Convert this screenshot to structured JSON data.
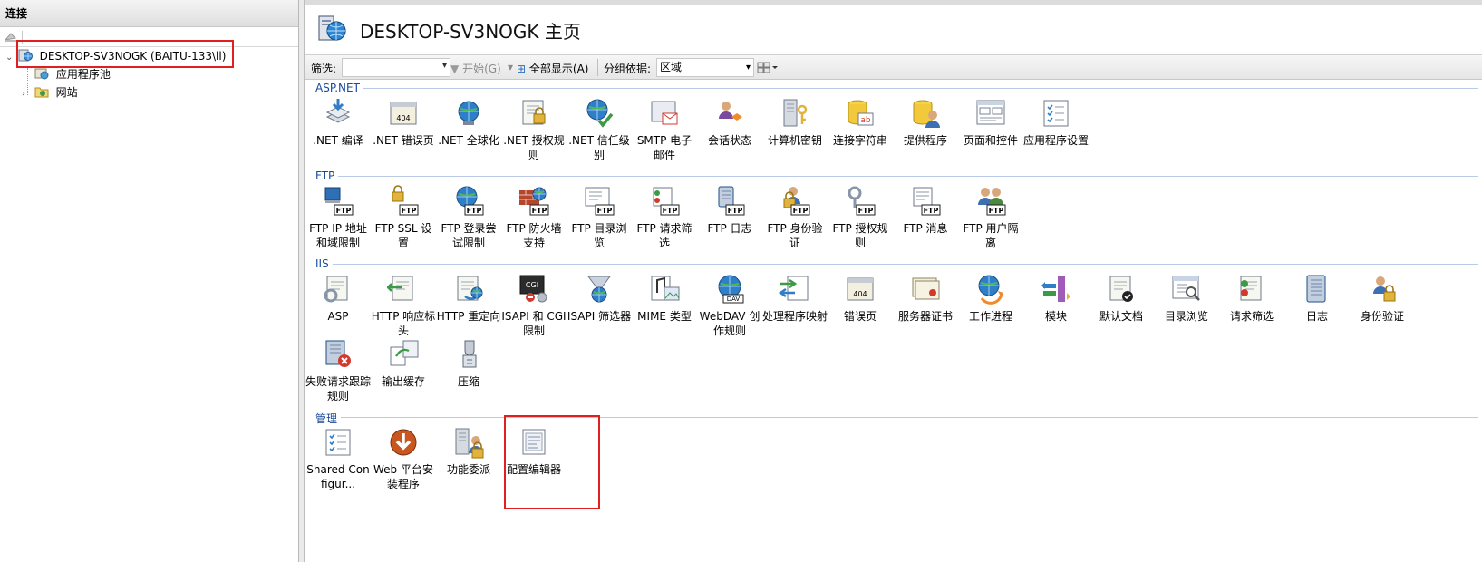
{
  "connections": {
    "header": "连接",
    "tree": {
      "server": "DESKTOP-SV3NOGK (BAITU-133\\ll)",
      "app_pools": "应用程序池",
      "sites": "网站"
    }
  },
  "title": "DESKTOP-SV3NOGK 主页",
  "filterbar": {
    "filter_label": "筛选:",
    "filter_value": "",
    "start_label": "开始(G)",
    "show_all_label": "全部显示(A)",
    "group_label": "分组依据:",
    "group_value": "区域"
  },
  "sections": [
    {
      "name": "ASP.NET",
      "items": [
        {
          "label": ".NET 编译",
          "icon": "compile-icon"
        },
        {
          "label": ".NET 错误页",
          "icon": "error-page-icon"
        },
        {
          "label": ".NET 全球化",
          "icon": "globe-icon"
        },
        {
          "label": ".NET 授权规则",
          "icon": "authz-icon"
        },
        {
          "label": ".NET 信任级别",
          "icon": "trust-icon"
        },
        {
          "label": "SMTP 电子邮件",
          "icon": "mail-icon"
        },
        {
          "label": "会话状态",
          "icon": "session-icon"
        },
        {
          "label": "计算机密钥",
          "icon": "machine-key-icon"
        },
        {
          "label": "连接字符串",
          "icon": "conn-string-icon"
        },
        {
          "label": "提供程序",
          "icon": "providers-icon"
        },
        {
          "label": "页面和控件",
          "icon": "pages-controls-icon"
        },
        {
          "label": "应用程序设置",
          "icon": "app-settings-icon"
        }
      ]
    },
    {
      "name": "FTP",
      "items": [
        {
          "label": "FTP IP 地址和域限制",
          "icon": "ftp-ip-icon"
        },
        {
          "label": "FTP SSL 设置",
          "icon": "ftp-ssl-icon"
        },
        {
          "label": "FTP 登录尝试限制",
          "icon": "ftp-logon-icon"
        },
        {
          "label": "FTP 防火墙支持",
          "icon": "ftp-firewall-icon"
        },
        {
          "label": "FTP 目录浏览",
          "icon": "ftp-dir-icon"
        },
        {
          "label": "FTP 请求筛选",
          "icon": "ftp-filter-icon"
        },
        {
          "label": "FTP 日志",
          "icon": "ftp-log-icon"
        },
        {
          "label": "FTP 身份验证",
          "icon": "ftp-auth-icon"
        },
        {
          "label": "FTP 授权规则",
          "icon": "ftp-authz-icon"
        },
        {
          "label": "FTP 消息",
          "icon": "ftp-message-icon"
        },
        {
          "label": "FTP 用户隔离",
          "icon": "ftp-isolation-icon"
        }
      ]
    },
    {
      "name": "IIS",
      "items": [
        {
          "label": "ASP",
          "icon": "asp-icon"
        },
        {
          "label": "HTTP 响应标头",
          "icon": "http-headers-icon"
        },
        {
          "label": "HTTP 重定向",
          "icon": "http-redirect-icon"
        },
        {
          "label": "ISAPI 和 CGI 限制",
          "icon": "isapi-cgi-icon"
        },
        {
          "label": "ISAPI 筛选器",
          "icon": "isapi-filter-icon"
        },
        {
          "label": "MIME 类型",
          "icon": "mime-icon"
        },
        {
          "label": "WebDAV 创作规则",
          "icon": "webdav-icon"
        },
        {
          "label": "处理程序映射",
          "icon": "handler-icon"
        },
        {
          "label": "错误页",
          "icon": "error-page-icon"
        },
        {
          "label": "服务器证书",
          "icon": "certificate-icon"
        },
        {
          "label": "工作进程",
          "icon": "worker-process-icon"
        },
        {
          "label": "模块",
          "icon": "modules-icon"
        },
        {
          "label": "默认文档",
          "icon": "default-doc-icon"
        },
        {
          "label": "目录浏览",
          "icon": "dir-browse-icon"
        },
        {
          "label": "请求筛选",
          "icon": "request-filter-icon"
        },
        {
          "label": "日志",
          "icon": "log-icon"
        },
        {
          "label": "身份验证",
          "icon": "authentication-icon"
        },
        {
          "label": "失败请求跟踪规则",
          "icon": "failed-request-icon"
        },
        {
          "label": "输出缓存",
          "icon": "output-cache-icon"
        },
        {
          "label": "压缩",
          "icon": "compression-icon"
        }
      ]
    },
    {
      "name": "管理",
      "items": [
        {
          "label": "Shared Configur...",
          "icon": "shared-config-icon"
        },
        {
          "label": "Web 平台安装程序",
          "icon": "web-platform-icon"
        },
        {
          "label": "功能委派",
          "icon": "delegation-icon"
        },
        {
          "label": "配置编辑器",
          "icon": "config-editor-icon"
        }
      ]
    }
  ]
}
